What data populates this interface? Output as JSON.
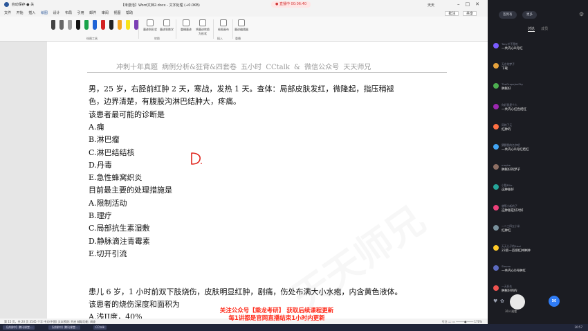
{
  "window": {
    "title": "【未激活】Word文档2.docx - 文字处理 (+0.0KB)",
    "live_badge": "● 直播中 00:06:40",
    "user": "天天",
    "quick_access": "自动保存 ● 关"
  },
  "menu": {
    "items": [
      "文件",
      "开始",
      "插入",
      "绘图",
      "设计",
      "布局",
      "引用",
      "邮件",
      "审阅",
      "视图",
      "帮助"
    ],
    "active_index": 3,
    "right_buttons": [
      "批注",
      "共享"
    ]
  },
  "ribbon": {
    "tools": [
      {
        "name": "select-tool-icon",
        "color": "#444444"
      },
      {
        "name": "lasso-tool-icon",
        "color": "#666666"
      },
      {
        "name": "eraser-tool-icon",
        "color": "#9e9e9e"
      },
      {
        "name": "black-pen-icon",
        "color": "#111111"
      },
      {
        "name": "green-pen-icon",
        "color": "#1aa34a"
      },
      {
        "name": "blue-pen-icon",
        "color": "#1e63d6"
      },
      {
        "name": "red-pen-icon",
        "color": "#d32121"
      },
      {
        "name": "black-pen-2-icon",
        "color": "#222222"
      },
      {
        "name": "orange-highlighter-icon",
        "color": "#f5a623"
      },
      {
        "name": "yellow-highlighter-icon",
        "color": "#f8e31b"
      },
      {
        "name": "purple-pen-icon",
        "color": "#7b3fb5"
      }
    ],
    "groups": [
      {
        "label": "墨迹到形状"
      },
      {
        "label": "墨迹到数学"
      },
      {
        "label": "重播墨迹"
      },
      {
        "label": "将墨迹转换为形状"
      },
      {
        "label": "绘图画布"
      },
      {
        "label": "墨迹编辑器"
      }
    ],
    "group_names": [
      "绘图工具",
      "转换",
      "插入",
      "重播"
    ]
  },
  "document": {
    "header": "冲刺十年真题  病例分析&狂背&四套卷  五小时        CCtalk &  微信公众号  天天师兄",
    "lines": [
      "男，25 岁，右胫前红肿 2 天，寒战，发热 1 天。查体：局部皮肤发红，微隆起，指压稍褪",
      "色，边界清楚，有腹股沟淋巴结肿大，疼痛。",
      "该患者最可能的诊断是",
      "A.痈",
      "B.淋巴瘤",
      "C.淋巴结结核",
      "D.丹毒",
      "E.急性蜂窝织炎",
      "目前最主要的处理措施是",
      "A.限制活动",
      "B.理疗",
      "C.局部抗生素湿敷",
      "D.静脉滴注青霉素",
      "E.切开引流",
      "",
      "",
      "患儿 6 岁，1 小时前双下肢烧伤，皮肤明显红肿，剧痛，伤处布满大小水疱，内含黄色液体。",
      "该患者的烧伤深度和面积为",
      "A.浅II度，40%"
    ],
    "watermark": "天天师兄",
    "pen_mark_color": "#e0241b"
  },
  "statusbar": {
    "left": "第 15 页，共 20 页    3545 个字    中文(中国)    文本预测: 开启    辅助功能: 调查",
    "right": "专注    📖    ▭    ─────●──── 170%"
  },
  "banner": {
    "line1": "关注公众号【乘龙考研】 获取后续课程更新",
    "line2": "每1讲都是官网直播结束1小时内更新"
  },
  "taskbar": {
    "items": [
      "【讲课中】腾讯课堂...",
      "【讲课中】腾讯课堂...",
      "CCtalk"
    ]
  },
  "panel": {
    "top_pills": [
      "签到有",
      "更多"
    ],
    "tabs": [
      "讨论",
      "成员"
    ],
    "active_tab": 0,
    "messages": [
      {
        "name": "Tony才不是吃",
        "text": "一共内心D丹红",
        "color": "#7a5cff"
      },
      {
        "name": "无名的梦子",
        "text": "下载",
        "color": "#e6a23c"
      },
      {
        "name": "TheGrapeJoeSky",
        "text": "肿胀好",
        "color": "#4caf50"
      },
      {
        "name": "你好我是个人",
        "text": "一共内心红色结红",
        "color": "#9c27b0"
      },
      {
        "name": "同的了元",
        "text": "红肿的",
        "color": "#ff7043"
      },
      {
        "name": "猜猜我的名字吧",
        "text": "一共内心D丹红结红",
        "color": "#42a5f5"
      },
      {
        "name": "maybe",
        "text": "肿胀好的梦子",
        "color": "#8d6e63"
      },
      {
        "name": "小猫Ellie",
        "text": "这肿胀好",
        "color": "#26a69a"
      },
      {
        "name": "就等小新的了",
        "text": "这肿胀是好对好",
        "color": "#ec407a"
      },
      {
        "name": "一二三四五小米",
        "text": "红肿红",
        "color": "#78909c"
      },
      {
        "name": "天天儿子的Alexi",
        "text": "23第一首感红肿肿肿",
        "color": "#ffca28"
      },
      {
        "name": "Steven",
        "text": "一共内心D丹肿红",
        "color": "#5c6bc0"
      },
      {
        "name": "一天好先",
        "text": "肿胀好的的",
        "color": "#ef5350"
      }
    ],
    "viewers": "30人观看",
    "clock": "20:57"
  }
}
